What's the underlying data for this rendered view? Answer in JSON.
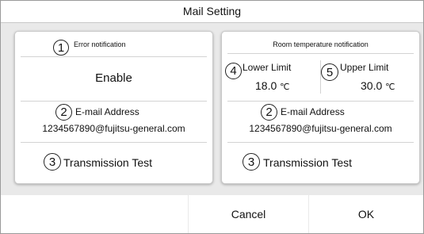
{
  "title": "Mail Setting",
  "error_panel": {
    "marker_1": "1",
    "heading": "Error notification",
    "status": "Enable",
    "marker_2": "2",
    "email_label": "E-mail Address",
    "email_value": "1234567890@fujitsu-general.com",
    "marker_3": "3",
    "test_label": "Transmission Test"
  },
  "room_panel": {
    "heading": "Room temperature notification",
    "marker_4": "4",
    "lower_label": "Lower Limit",
    "lower_value": "18.0",
    "lower_unit": "℃",
    "marker_5": "5",
    "upper_label": "Upper Limit",
    "upper_value": "30.0",
    "upper_unit": "℃",
    "marker_2": "2",
    "email_label": "E-mail Address",
    "email_value": "1234567890@fujitsu-general.com",
    "marker_3": "3",
    "test_label": "Transmission Test"
  },
  "footer": {
    "cancel_label": "Cancel",
    "ok_label": "OK"
  }
}
